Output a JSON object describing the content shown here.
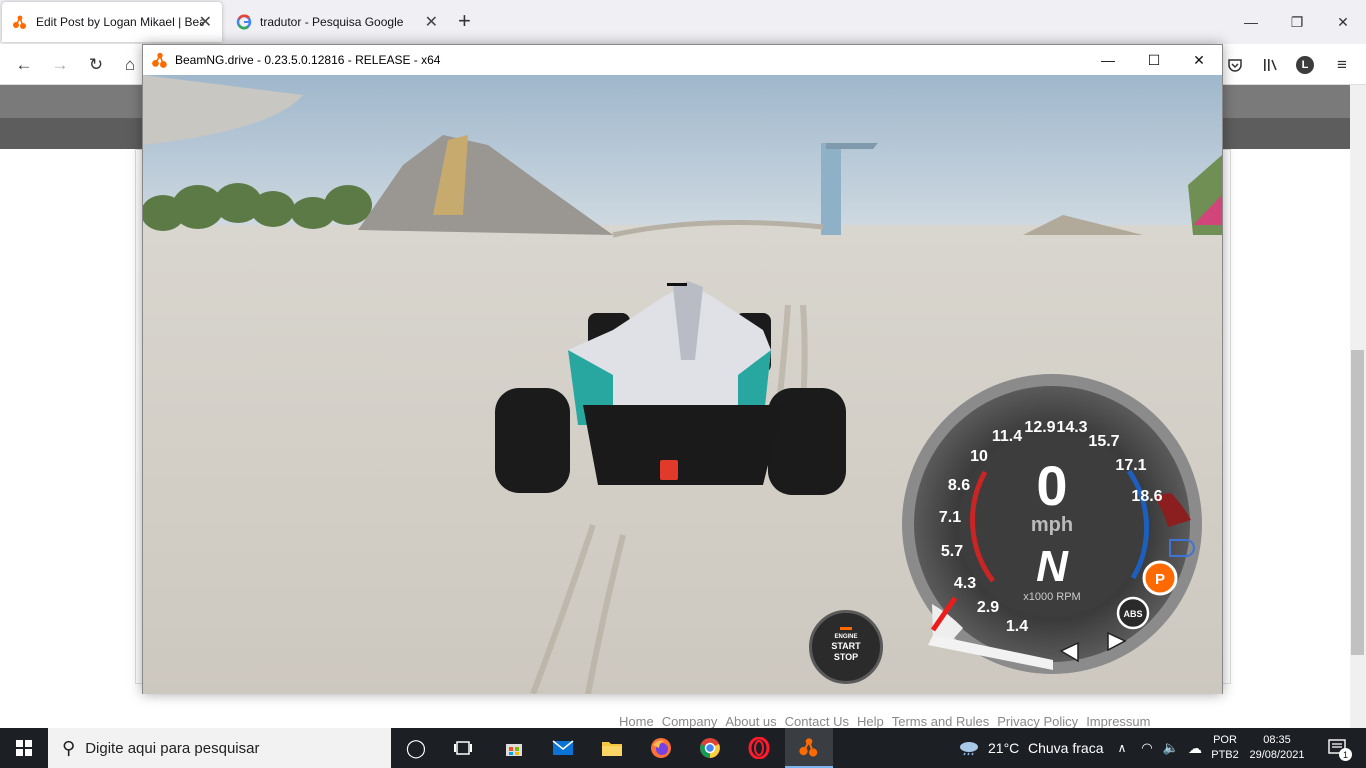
{
  "browser": {
    "tabs": [
      {
        "title": "Edit Post by Logan Mikael | Beam",
        "active": true
      },
      {
        "title": "tradutor - Pesquisa Google",
        "active": false
      }
    ],
    "new_tab": "+",
    "profile_initial": "L"
  },
  "website": {
    "footer_links": [
      "Home",
      "Company",
      "About us",
      "Contact Us",
      "Help",
      "Terms and Rules",
      "Privacy Policy",
      "Impressum"
    ]
  },
  "game_window": {
    "title": "BeamNG.drive - 0.23.5.0.12816 - RELEASE - x64",
    "engine_button": {
      "line1": "ENGINE",
      "line2": "START",
      "line3": "STOP"
    },
    "gauge": {
      "speed": "0",
      "speed_unit": "mph",
      "gear": "N",
      "rpm_label": "x1000 RPM",
      "scale": [
        "1.4",
        "2.9",
        "4.3",
        "5.7",
        "7.1",
        "8.6",
        "10",
        "11.4",
        "12.9",
        "14.3",
        "15.7",
        "17.1",
        "18.6"
      ],
      "park_label": "P",
      "abs_label": "ABS"
    }
  },
  "taskbar": {
    "search_placeholder": "Digite aqui para pesquisar",
    "weather_temp": "21°C",
    "weather_desc": "Chuva fraca",
    "lang_top": "POR",
    "lang_bottom": "PTB2",
    "time": "08:35",
    "date": "29/08/2021",
    "notif_count": "1"
  }
}
